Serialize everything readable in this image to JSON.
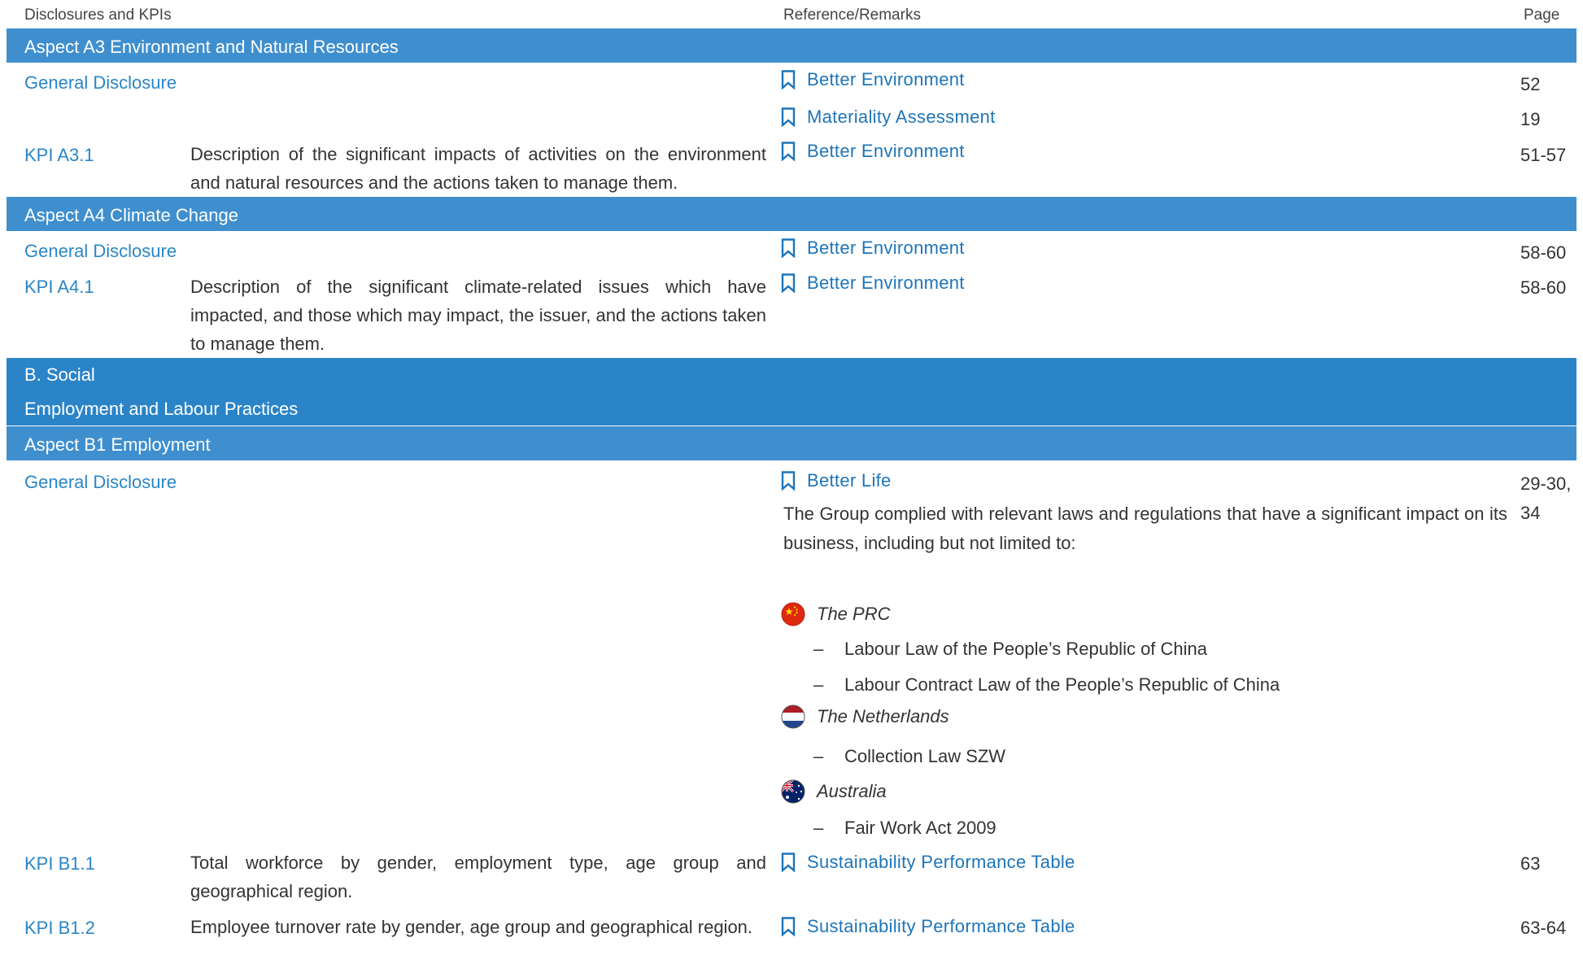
{
  "header": {
    "col1": "Disclosures and KPIs",
    "col2": "Reference/Remarks",
    "col3": "Page"
  },
  "sections": {
    "a3": "Aspect A3 Environment and Natural Resources",
    "a4": "Aspect A4 Climate Change",
    "b_social": "B. Social",
    "employment_labour": "Employment and Labour Practices",
    "b1": "Aspect B1 Employment"
  },
  "rows": {
    "a3_gd": {
      "label": "General Disclosure",
      "refs": [
        "Better Environment",
        "Materiality Assessment"
      ],
      "pages": [
        "52",
        "19"
      ]
    },
    "a3_kpi1": {
      "label": "KPI A3.1",
      "desc": "Description of the significant impacts of activities on the environment and natural resources and the actions taken to manage them.",
      "ref": "Better Environment",
      "page": "51-57"
    },
    "a4_gd": {
      "label": "General Disclosure",
      "ref": "Better Environment",
      "page": "58-60"
    },
    "a4_kpi1": {
      "label": "KPI A4.1",
      "desc": "Description of the significant climate-related issues which have impacted, and those which may impact, the issuer, and the actions taken to manage them.",
      "ref": "Better Environment",
      "page": "58-60"
    },
    "b1_gd": {
      "label": "General Disclosure",
      "ref": "Better Life",
      "page_line1": "29-30,",
      "page_line2": "34",
      "remark": "The Group complied with relevant laws and regulations that have a significant impact on its business, including but not limited to:",
      "countries": [
        {
          "name": "The PRC",
          "flag": "china-flag-icon",
          "laws": [
            "Labour Law of the People’s Republic of China",
            "Labour Contract Law of the People’s Republic of China"
          ]
        },
        {
          "name": "The Netherlands",
          "flag": "netherlands-flag-icon",
          "laws": [
            "Collection Law SZW"
          ]
        },
        {
          "name": "Australia",
          "flag": "australia-flag-icon",
          "laws": [
            "Fair Work Act 2009"
          ]
        }
      ],
      "dash": "–"
    },
    "b1_kpi1": {
      "label": "KPI B1.1",
      "desc": "Total workforce by gender, employment type, age group and geographical region.",
      "ref": "Sustainability Performance Table",
      "page": "63"
    },
    "b1_kpi2": {
      "label": "KPI B1.2",
      "desc": "Employee turnover rate by gender, age group and geographical region.",
      "ref": "Sustainability Performance Table",
      "page": "63-64"
    }
  },
  "colors": {
    "band": "#3f8fcf",
    "band_dark": "#2b84c8",
    "link_blue": "#1e75b8",
    "label_blue": "#2a86c6"
  },
  "icons": {
    "reference": "bookmark-icon"
  }
}
